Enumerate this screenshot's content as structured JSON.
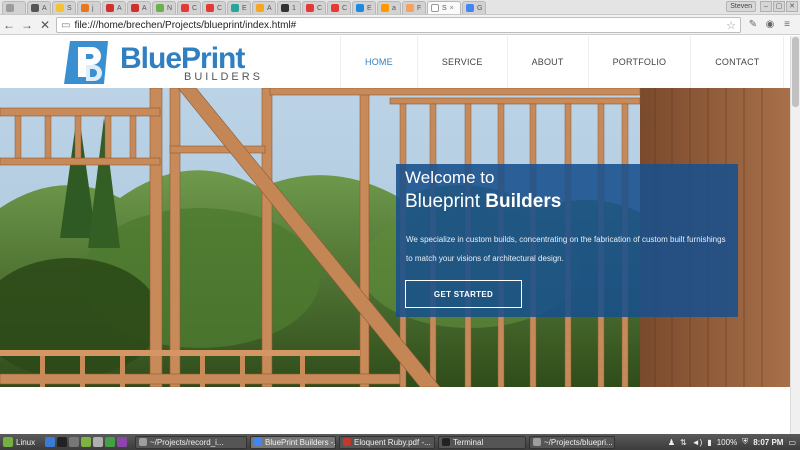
{
  "browser": {
    "tabs": [
      {
        "label": "",
        "color": "#9c9c9c"
      },
      {
        "label": "A",
        "color": "#555555"
      },
      {
        "label": "S",
        "color": "#f4c430"
      },
      {
        "label": "j",
        "color": "#e87722"
      },
      {
        "label": "A",
        "color": "#d32f2f"
      },
      {
        "label": "A",
        "color": "#d32f2f"
      },
      {
        "label": "N",
        "color": "#6ab04c"
      },
      {
        "label": "C",
        "color": "#e53935"
      },
      {
        "label": "C",
        "color": "#e53935"
      },
      {
        "label": "E",
        "color": "#26a69a"
      },
      {
        "label": "A",
        "color": "#f5a623"
      },
      {
        "label": "1",
        "color": "#333333"
      },
      {
        "label": "C",
        "color": "#e53935"
      },
      {
        "label": "C",
        "color": "#e53935"
      },
      {
        "label": "E",
        "color": "#1e88e5"
      },
      {
        "label": "a",
        "color": "#ff9900"
      },
      {
        "label": "F",
        "color": "#f4a261"
      },
      {
        "label": "S",
        "color": "#ffffff"
      },
      {
        "label": "G",
        "color": "#4285f4"
      }
    ],
    "active_tab_label": "S",
    "user_label": "Steven",
    "url": "file:///home/brechen/Projects/blueprint/index.html#"
  },
  "site": {
    "logo_main": "BluePrint",
    "logo_sub": "BUILDERS",
    "nav": [
      "HOME",
      "SERVICE",
      "ABOUT",
      "PORTFOLIO",
      "CONTACT"
    ],
    "active_nav": "HOME",
    "hero": {
      "line1": "Welcome to",
      "line2_plain": "Blueprint",
      "line2_bold": "Builders",
      "description": "We specialize in custom builds, concentrating on the fabrication of custom built furnishings to match your visions of architectural design.",
      "cta": "GET STARTED"
    },
    "brand_color": "#2f7fc1",
    "panel_color": "#18508c"
  },
  "taskbar": {
    "start_label": "Linux",
    "quicklaunch_colors": [
      "#3a7bd5",
      "#222222",
      "#777777",
      "#7cb342",
      "#b0b0b0",
      "#43a047",
      "#8e44ad"
    ],
    "tasks": [
      {
        "label": "~/Projects/record_i...",
        "color": "#9e9e9e"
      },
      {
        "label": "BluePrint Builders -...",
        "color": "#4285f4"
      },
      {
        "label": "Eloquent Ruby.pdf -...",
        "color": "#c0392b"
      },
      {
        "label": "Terminal",
        "color": "#222222"
      },
      {
        "label": "~/Projects/bluepri...",
        "color": "#9e9e9e"
      }
    ],
    "active_task": 1,
    "battery": "100%",
    "clock": "8:07 PM"
  }
}
